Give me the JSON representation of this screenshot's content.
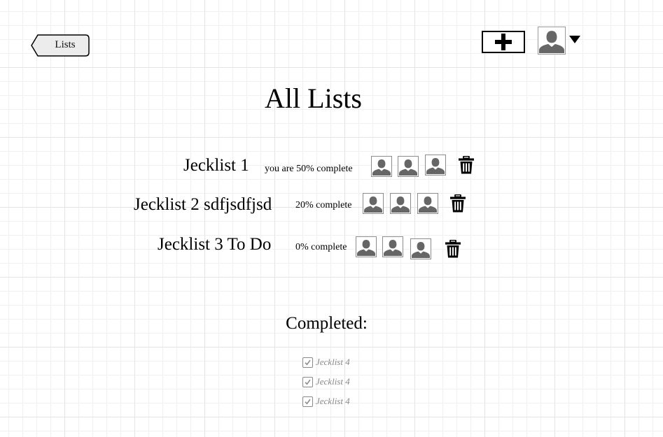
{
  "header": {
    "back_label": "Lists",
    "title": "All Lists"
  },
  "lists": [
    {
      "name": "Jecklist 1",
      "status": "you are 50% complete",
      "progress_percent": 50
    },
    {
      "name": "Jecklist 2 sdfjsdfjsd",
      "status": "20% complete",
      "progress_percent": 20
    },
    {
      "name": "Jecklist 3 To Do",
      "status": "0% complete",
      "progress_percent": 0
    }
  ],
  "completed": {
    "title": "Completed:",
    "items": [
      "Jecklist 4",
      "Jecklist 4",
      "Jecklist 4"
    ]
  },
  "icons": {
    "add": "plus-icon",
    "account": "user-avatar-icon",
    "menu_caret": "caret-down-icon",
    "member": "user-avatar-icon",
    "delete": "trash-icon",
    "done": "checkbox-checked-icon"
  },
  "colors": {
    "grid": "#e4e4e4",
    "avatar_fill": "#666666",
    "completed_text": "#8a8a8a"
  }
}
